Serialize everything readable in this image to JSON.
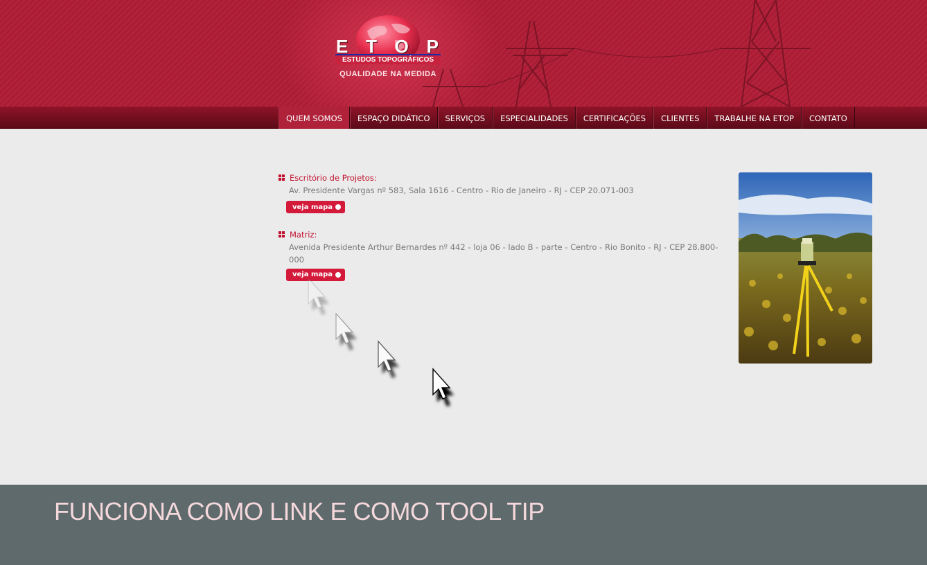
{
  "brand": {
    "letters": [
      "E",
      "T",
      "O",
      "P"
    ],
    "subtitle": "ESTUDOS TOPOGRÁFICOS",
    "tagline": "QUALIDADE NA MEDIDA"
  },
  "nav": {
    "items": [
      {
        "label": "QUEM SOMOS",
        "active": true
      },
      {
        "label": "ESPAÇO DIDÁTICO"
      },
      {
        "label": "SERVIÇOS"
      },
      {
        "label": "ESPECIALIDADES"
      },
      {
        "label": "CERTIFICAÇÕES"
      },
      {
        "label": "CLIENTES"
      },
      {
        "label": "TRABALHE NA ETOP"
      },
      {
        "label": "CONTATO"
      }
    ]
  },
  "offices": [
    {
      "title": "Escritório de Projetos:",
      "address": "Av. Presidente Vargas nº 583, Sala 1616 - Centro - Rio de Janeiro - RJ - CEP 20.071-003",
      "map_label": "veja mapa"
    },
    {
      "title": "Matriz:",
      "address": "Avenida Presidente Arthur Bernardes nº 442 - loja 06 - lado B - parte - Centro - Rio Bonito - RJ - CEP 28.800-000",
      "map_label": "veja mapa"
    }
  ],
  "footer": {
    "caption": "FUNCIONA COMO LINK E COMO TOOL TIP"
  },
  "colors": {
    "header": "#b3213a",
    "nav_active": "#b0213a",
    "accent": "#d41a3a",
    "footer": "#5e6a6b"
  }
}
